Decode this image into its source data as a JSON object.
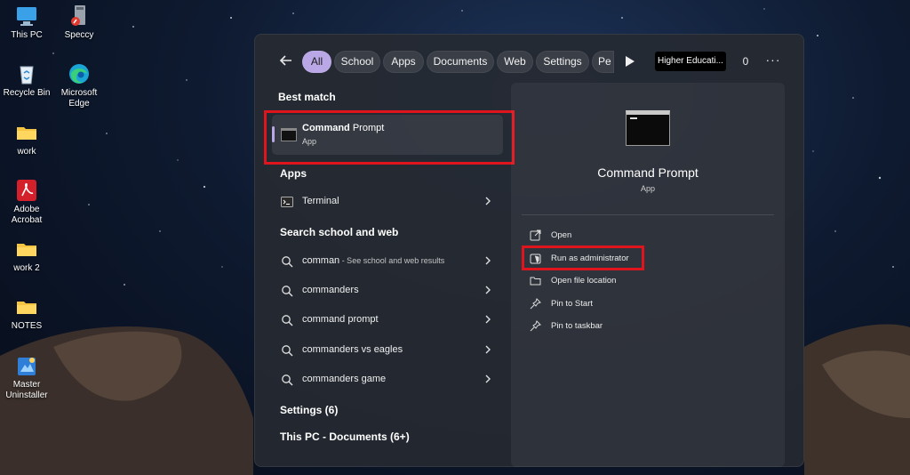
{
  "desktop": {
    "icons": [
      {
        "label": "This PC",
        "icon": "this-pc-icon"
      },
      {
        "label": "Speccy",
        "icon": "speccy-icon"
      },
      {
        "label": "Recycle Bin",
        "icon": "recycle-bin-icon"
      },
      {
        "label": "Microsoft Edge",
        "icon": "edge-icon"
      },
      {
        "label": "work",
        "icon": "folder-icon"
      },
      {
        "label": "Adobe Acrobat",
        "icon": "acrobat-icon"
      },
      {
        "label": "work 2",
        "icon": "folder-icon"
      },
      {
        "label": "NOTES",
        "icon": "folder-icon"
      },
      {
        "label": "Master Uninstaller",
        "icon": "uninstaller-icon"
      }
    ]
  },
  "search": {
    "filters": [
      {
        "label": "All",
        "active": true
      },
      {
        "label": "School",
        "active": false
      },
      {
        "label": "Apps",
        "active": false
      },
      {
        "label": "Documents",
        "active": false
      },
      {
        "label": "Web",
        "active": false
      },
      {
        "label": "Settings",
        "active": false
      },
      {
        "label": "Pe",
        "active": false
      }
    ],
    "highlight_label": "Higher Educati...",
    "points": "0",
    "more": "···",
    "best_match": {
      "section": "Best match",
      "name_bold": "Command",
      "name_rest": " Prompt",
      "type": "App"
    },
    "apps_section": "Apps",
    "apps": [
      {
        "label": "Terminal"
      }
    ],
    "web_section": "Search school and web",
    "web_results": [
      {
        "label": "comman",
        "sub": " - See school and web results"
      },
      {
        "label": "commanders",
        "sub": ""
      },
      {
        "label": "command prompt",
        "sub": ""
      },
      {
        "label": "commanders vs eagles",
        "sub": ""
      },
      {
        "label": "commanders game",
        "sub": ""
      }
    ],
    "settings_section": "Settings (6)",
    "documents_section": "This PC - Documents (6+)"
  },
  "details": {
    "title": "Command Prompt",
    "type": "App",
    "actions": [
      {
        "label": "Open",
        "icon": "open-external-icon"
      },
      {
        "label": "Run as administrator",
        "icon": "shield-admin-icon"
      },
      {
        "label": "Open file location",
        "icon": "folder-open-icon"
      },
      {
        "label": "Pin to Start",
        "icon": "pin-icon"
      },
      {
        "label": "Pin to taskbar",
        "icon": "pin-icon"
      }
    ]
  },
  "highlight_color": "#e0141c",
  "accent_color": "#b9a7e6"
}
